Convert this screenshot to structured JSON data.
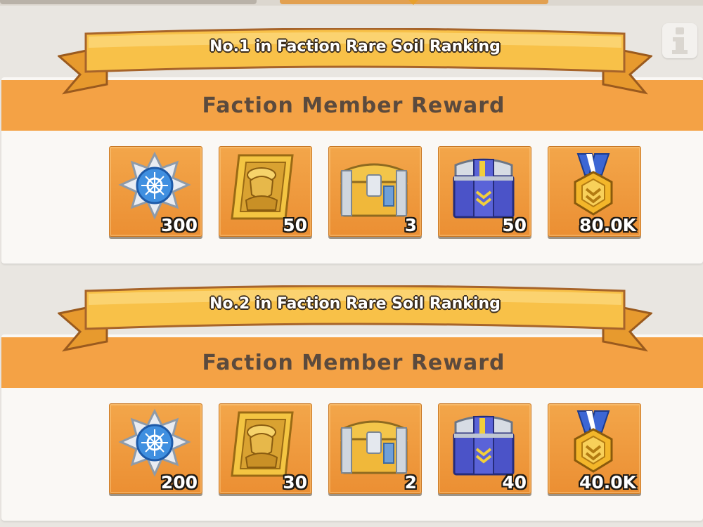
{
  "info_button": {
    "icon": "info-icon"
  },
  "sections": [
    {
      "title": "No.1 in Faction Rare Soil Ranking",
      "reward_label": "Faction Member Reward",
      "items": [
        {
          "icon": "star-medal-icon",
          "quantity": "300"
        },
        {
          "icon": "golden-portrait-icon",
          "quantity": "50"
        },
        {
          "icon": "gold-chest-icon",
          "quantity": "3"
        },
        {
          "icon": "supply-crate-icon",
          "quantity": "50"
        },
        {
          "icon": "gold-medal-icon",
          "quantity": "80.0K"
        }
      ]
    },
    {
      "title": "No.2 in Faction Rare Soil Ranking",
      "reward_label": "Faction Member Reward",
      "items": [
        {
          "icon": "star-medal-icon",
          "quantity": "200"
        },
        {
          "icon": "golden-portrait-icon",
          "quantity": "30"
        },
        {
          "icon": "gold-chest-icon",
          "quantity": "2"
        },
        {
          "icon": "supply-crate-icon",
          "quantity": "40"
        },
        {
          "icon": "gold-medal-icon",
          "quantity": "40.0K"
        }
      ]
    }
  ],
  "colors": {
    "reward_band": "#f4a245",
    "item_tile": "#eb8f33",
    "ribbon": "#f8c148",
    "reward_text": "#5b4a3d"
  }
}
